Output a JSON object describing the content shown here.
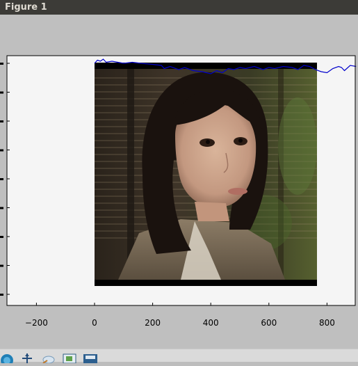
{
  "window": {
    "title": "Figure 1"
  },
  "colors": {
    "titlebar": "#3c3b37",
    "title_text": "#dfdbd2",
    "figure_bg": "#bfbfbf",
    "axes_bg": "#f5f5f5",
    "line": "#0000cc",
    "image_border": "#000000"
  },
  "chart_data": {
    "type": "line",
    "title": "",
    "xlabel": "",
    "ylabel": "",
    "xlim": [
      -300,
      900
    ],
    "x_ticks": [
      -200,
      0,
      200,
      400,
      600,
      800
    ],
    "x_tick_labels": [
      "−200",
      "0",
      "200",
      "400",
      "600",
      "800"
    ],
    "y_tick_labels_visible": false,
    "y_tick_count": 9,
    "grid": false,
    "background_image": {
      "kind": "photo-portrait",
      "x_extent": [
        0,
        770
      ]
    },
    "series": [
      {
        "x": [
          0,
          10,
          20,
          30,
          40,
          60,
          80,
          100,
          130,
          160,
          200,
          230,
          240,
          260,
          290,
          310,
          340,
          370,
          400,
          420,
          440,
          460,
          480,
          500,
          520,
          550,
          580,
          600,
          620,
          650,
          680,
          700,
          720,
          740,
          760,
          780,
          800,
          820,
          840,
          850,
          860,
          880,
          900
        ],
        "y": [
          0,
          3,
          2,
          4,
          1,
          2,
          1,
          0,
          1,
          0,
          -1,
          -2,
          -5,
          -3,
          -6,
          -4,
          -7,
          -8,
          -10,
          -7,
          -9,
          -5,
          -6,
          -4,
          -5,
          -3,
          -6,
          -4,
          -5,
          -3,
          -4,
          -6,
          -2,
          -3,
          -6,
          -8,
          -9,
          -5,
          -3,
          -4,
          -7,
          -2,
          -3
        ]
      }
    ]
  }
}
